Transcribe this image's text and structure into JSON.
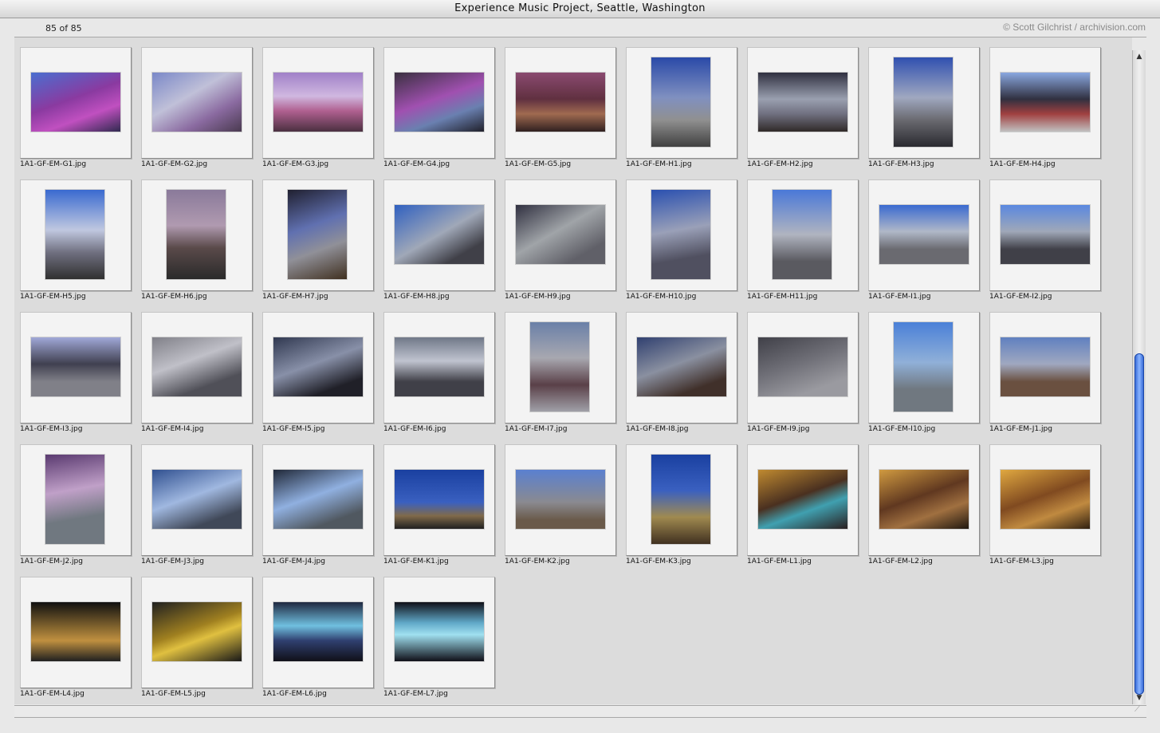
{
  "window": {
    "title": "Experience Music Project, Seattle, Washington"
  },
  "status": {
    "count": "85 of 85",
    "credit": "© Scott Gilchrist / archivision.com"
  },
  "icons": {
    "scroll_up": "scroll-up-arrow-icon",
    "scroll_down": "scroll-down-arrow-icon",
    "resize": "resize-grip-icon"
  },
  "images": [
    {
      "file": "1A1-GF-EM-G1.jpg",
      "orient": "land",
      "bg": "linear-gradient(160deg,#4a6fd0,#8a3aa0 45%,#c050c0 70%,#302a50)"
    },
    {
      "file": "1A1-GF-EM-G2.jpg",
      "orient": "land",
      "bg": "linear-gradient(150deg,#7a88c8,#c0c0d8 40%,#8a6aa0 70%,#4a3a50)"
    },
    {
      "file": "1A1-GF-EM-G3.jpg",
      "orient": "land",
      "bg": "linear-gradient(180deg,#a080c8,#d0b8e0 40%,#b06090 65%,#4a3040)"
    },
    {
      "file": "1A1-GF-EM-G4.jpg",
      "orient": "land",
      "bg": "linear-gradient(160deg,#3a3040,#a050b0 45%,#6a80b0 70%,#20202a)"
    },
    {
      "file": "1A1-GF-EM-G5.jpg",
      "orient": "land",
      "bg": "linear-gradient(180deg,#8a4a70,#603040 45%,#a06a50 70%,#302020)"
    },
    {
      "file": "1A1-GF-EM-H1.jpg",
      "orient": "port",
      "bg": "linear-gradient(180deg,#2a4aa8,#8090c0 45%,#909090 70%,#404040)"
    },
    {
      "file": "1A1-GF-EM-H2.jpg",
      "orient": "land",
      "bg": "linear-gradient(180deg,#303040,#9aa0b0 45%,#707080 70%,#302a28)"
    },
    {
      "file": "1A1-GF-EM-H3.jpg",
      "orient": "port",
      "bg": "linear-gradient(180deg,#3050b0,#a0a8c0 45%,#6a6a70 70%,#2a2a30)"
    },
    {
      "file": "1A1-GF-EM-H4.jpg",
      "orient": "land",
      "bg": "linear-gradient(180deg,#8aa8e0,#303040 45%,#a04040 70%,#c0c0c0)"
    },
    {
      "file": "1A1-GF-EM-H5.jpg",
      "orient": "port",
      "bg": "linear-gradient(180deg,#3a6ad0,#c0c8e0 45%,#707080 70%,#303030)"
    },
    {
      "file": "1A1-GF-EM-H6.jpg",
      "orient": "port",
      "bg": "linear-gradient(180deg,#8a7a9a,#b09ab0 40%,#5a4a4a 65%,#2a2a2a)"
    },
    {
      "file": "1A1-GF-EM-H7.jpg",
      "orient": "port",
      "bg": "linear-gradient(160deg,#202030,#6070b0 40%,#909098 65%,#403020)"
    },
    {
      "file": "1A1-GF-EM-H8.jpg",
      "orient": "land",
      "bg": "linear-gradient(150deg,#3060c0,#a0a8b8 50%,#404048 80%)"
    },
    {
      "file": "1A1-GF-EM-H9.jpg",
      "orient": "land",
      "bg": "linear-gradient(150deg,#303040,#a0a4a8 45%,#606068 80%)"
    },
    {
      "file": "1A1-GF-EM-H10.jpg",
      "orient": "port",
      "bg": "linear-gradient(170deg,#2a50b0,#9aa0b8 45%,#505060 75%)"
    },
    {
      "file": "1A1-GF-EM-H11.jpg",
      "orient": "port",
      "bg": "linear-gradient(180deg,#4a78d8,#b0b4c0 50%,#5a5a60 80%)"
    },
    {
      "file": "1A1-GF-EM-I1.jpg",
      "orient": "land",
      "bg": "linear-gradient(180deg,#3a6ad0,#b0b8c8 45%,#6a6a70 75%)"
    },
    {
      "file": "1A1-GF-EM-I2.jpg",
      "orient": "land",
      "bg": "linear-gradient(180deg,#5a88e0,#a0a8b8 45%,#404048 75%)"
    },
    {
      "file": "1A1-GF-EM-I3.jpg",
      "orient": "land",
      "bg": "linear-gradient(180deg,#a0a8d8,#404050 45%,#808088 75%)"
    },
    {
      "file": "1A1-GF-EM-I4.jpg",
      "orient": "land",
      "bg": "linear-gradient(160deg,#808088,#c0c0c8 40%,#505058 75%)"
    },
    {
      "file": "1A1-GF-EM-I5.jpg",
      "orient": "land",
      "bg": "linear-gradient(160deg,#303850,#8890a8 45%,#202028 80%)"
    },
    {
      "file": "1A1-GF-EM-I6.jpg",
      "orient": "land",
      "bg": "linear-gradient(180deg,#707888,#c0c4d0 40%,#404048 75%)"
    },
    {
      "file": "1A1-GF-EM-I7.jpg",
      "orient": "port",
      "bg": "linear-gradient(180deg,#6a80a8,#a8a8b0 40%,#5a4048 70%,#a0a0a8)"
    },
    {
      "file": "1A1-GF-EM-I8.jpg",
      "orient": "land",
      "bg": "linear-gradient(160deg,#304070,#8a90a0 45%,#40302a 80%)"
    },
    {
      "file": "1A1-GF-EM-I9.jpg",
      "orient": "land",
      "bg": "linear-gradient(160deg,#404048,#707078 45%,#9a9aa0 80%)"
    },
    {
      "file": "1A1-GF-EM-I10.jpg",
      "orient": "port",
      "bg": "linear-gradient(180deg,#4a80d8,#90b0d8 45%,#707880 75%)"
    },
    {
      "file": "1A1-GF-EM-J1.jpg",
      "orient": "land",
      "bg": "linear-gradient(180deg,#6080c0,#a0a8c0 45%,#6a5040 75%)"
    },
    {
      "file": "1A1-GF-EM-J2.jpg",
      "orient": "port",
      "bg": "linear-gradient(170deg,#5a3a70,#c0a0c8 40%,#707880 70%)"
    },
    {
      "file": "1A1-GF-EM-J3.jpg",
      "orient": "land",
      "bg": "linear-gradient(160deg,#305090,#a0b8e0 45%,#404858 80%)"
    },
    {
      "file": "1A1-GF-EM-J4.jpg",
      "orient": "land",
      "bg": "linear-gradient(160deg,#202838,#90b0e0 45%,#505860 80%)"
    },
    {
      "file": "1A1-GF-EM-K1.jpg",
      "orient": "land",
      "bg": "linear-gradient(180deg,#1a40a0,#3a60c0 55%,#806a4a 78%,#202020)"
    },
    {
      "file": "1A1-GF-EM-K2.jpg",
      "orient": "land",
      "bg": "linear-gradient(180deg,#5a80d0,#8a8a90 55%,#6a5a4a 85%)"
    },
    {
      "file": "1A1-GF-EM-K3.jpg",
      "orient": "port",
      "bg": "linear-gradient(180deg,#1a40a0,#3a60c0 40%,#a08a50 70%,#403020)"
    },
    {
      "file": "1A1-GF-EM-L1.jpg",
      "orient": "land",
      "bg": "linear-gradient(160deg,#c08a30,#4a3020 45%,#40a0b0 65%,#2a2020)"
    },
    {
      "file": "1A1-GF-EM-L2.jpg",
      "orient": "land",
      "bg": "linear-gradient(160deg,#d09a40,#603820 45%,#a07040 70%,#201810)"
    },
    {
      "file": "1A1-GF-EM-L3.jpg",
      "orient": "land",
      "bg": "linear-gradient(160deg,#e0a840,#804a20 45%,#c08a40 70%,#302010)"
    },
    {
      "file": "1A1-GF-EM-L4.jpg",
      "orient": "land",
      "bg": "linear-gradient(180deg,#101010,#8a6a30 45%,#c09040 65%,#202020)"
    },
    {
      "file": "1A1-GF-EM-L5.jpg",
      "orient": "land",
      "bg": "linear-gradient(160deg,#202020,#a08020 45%,#e0c040 60%,#181818)"
    },
    {
      "file": "1A1-GF-EM-L6.jpg",
      "orient": "land",
      "bg": "linear-gradient(180deg,#202840,#70c0e0 40%,#304070 65%,#101018)"
    },
    {
      "file": "1A1-GF-EM-L7.jpg",
      "orient": "land",
      "bg": "linear-gradient(180deg,#101018,#60a8c8 35%,#a0e0f0 55%,#101018)"
    }
  ]
}
